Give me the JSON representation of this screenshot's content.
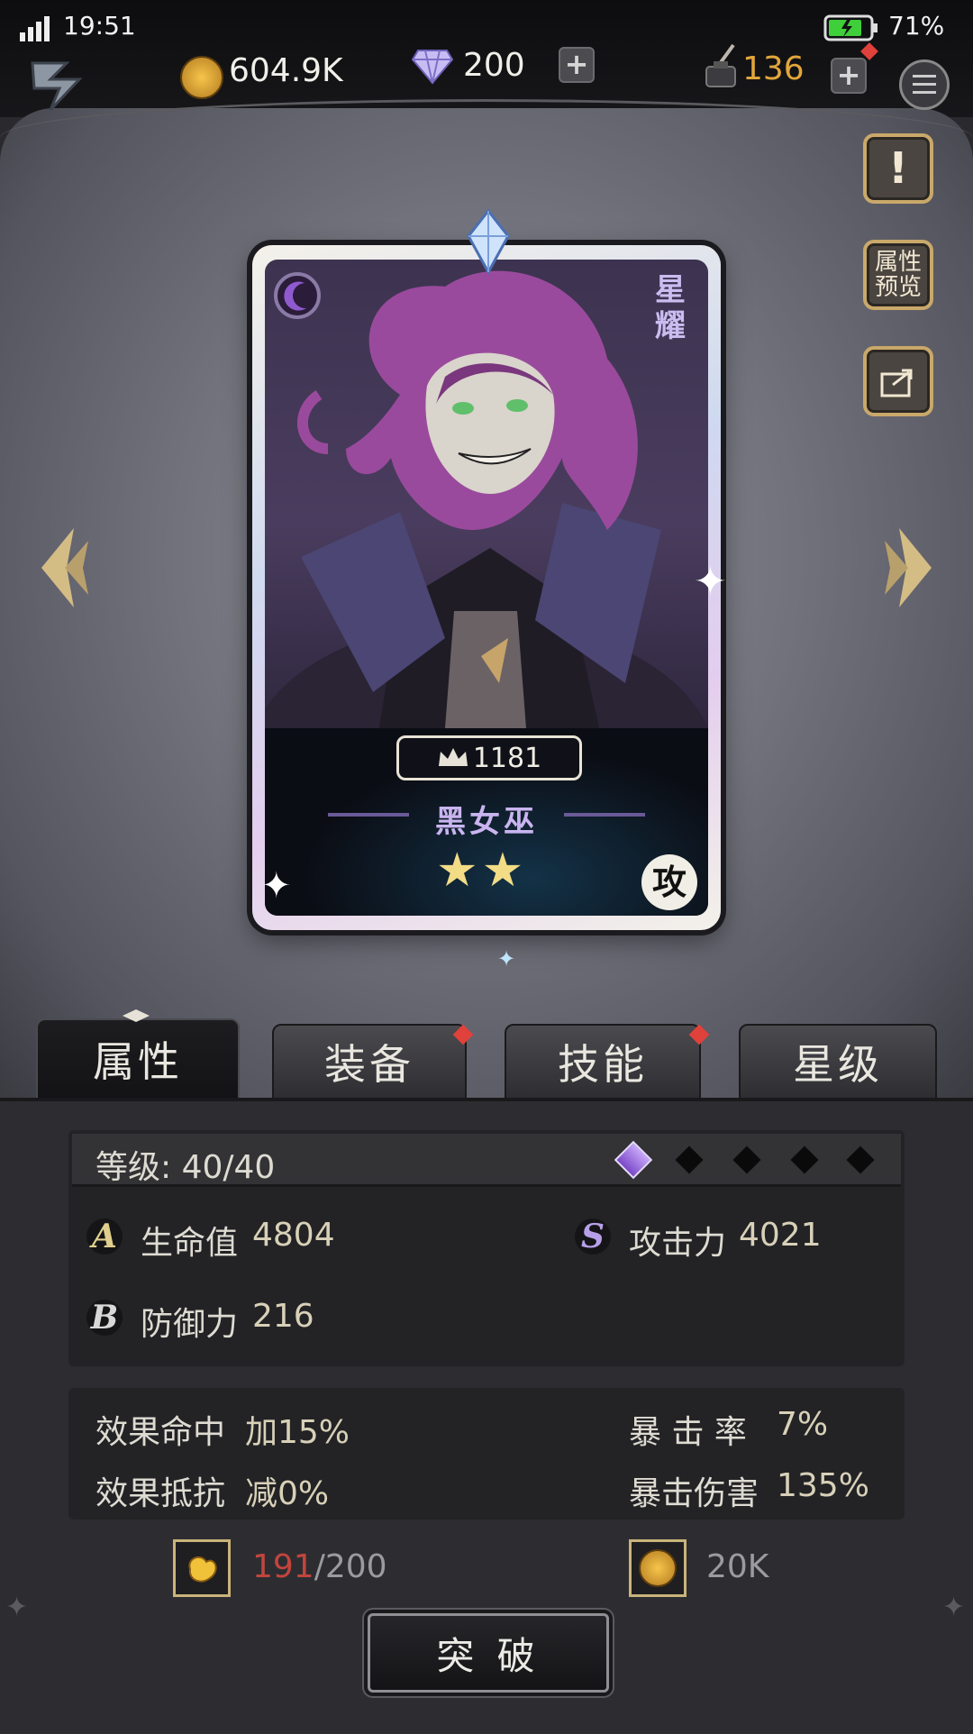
{
  "status": {
    "time": "19:51",
    "battery": "71%"
  },
  "resources": {
    "gold": "604.9K",
    "gems": "200",
    "ink": "136"
  },
  "side_buttons": {
    "info": "!",
    "preview": "属性\n预览"
  },
  "card": {
    "power": "1181",
    "name": "黑女巫",
    "rank_text": "星\n耀",
    "role": "攻",
    "stars": 2
  },
  "tabs": [
    "属性",
    "装备",
    "技能",
    "星级"
  ],
  "stats": {
    "level_label": "等级: 40/40",
    "hp_label": "生命值",
    "hp_value": "4804",
    "atk_label": "攻击力",
    "atk_value": "4021",
    "def_label": "防御力",
    "def_value": "216",
    "badge_a": "A",
    "badge_s": "S",
    "badge_b": "B"
  },
  "extra": {
    "hit_label": "效果命中",
    "hit_value": "加15%",
    "crit_label": "暴 击 率",
    "crit_value": "7%",
    "resist_label": "效果抵抗",
    "resist_value": "减0%",
    "critdmg_label": "暴击伤害",
    "critdmg_value": "135%"
  },
  "cost": {
    "material_have": "191",
    "material_need": "/200",
    "gold": "20K"
  },
  "breakthrough": "突 破",
  "colors": {
    "accent_gold": "#e2a63a",
    "material_red": "#c2453d"
  }
}
